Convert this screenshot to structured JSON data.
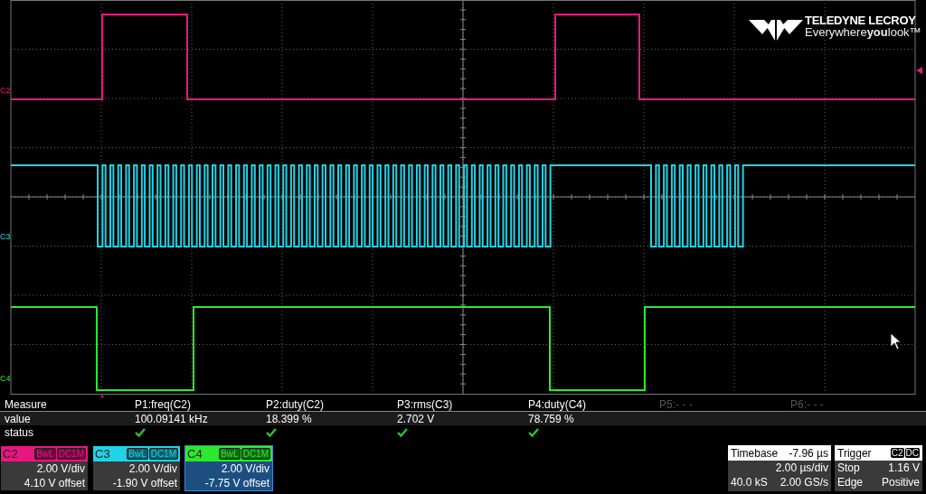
{
  "logo": {
    "brand": "TELEDYNE LECROY",
    "tagline": "Everywhere**you**look™"
  },
  "traces": [
    {
      "label": "C2",
      "color": "#e8177f"
    },
    {
      "label": "C3",
      "color": "#22d3e6"
    },
    {
      "label": "C4",
      "color": "#2ee82e"
    }
  ],
  "measure": {
    "header_label": "Measure",
    "value_label": "value",
    "status_label": "status",
    "params": [
      {
        "name": "P1:freq(C2)",
        "value": "100.09141 kHz",
        "status_ok": true,
        "active": true
      },
      {
        "name": "P2:duty(C2)",
        "value": "18.399 %",
        "status_ok": true,
        "active": true
      },
      {
        "name": "P3:rms(C3)",
        "value": "2.702 V",
        "status_ok": true,
        "active": true
      },
      {
        "name": "P4:duty(C4)",
        "value": "78.759 %",
        "status_ok": true,
        "active": true
      },
      {
        "name": "P5:- - -",
        "active": false,
        "status_ok": false
      },
      {
        "name": "P6:- - -",
        "active": false,
        "status_ok": false
      }
    ]
  },
  "channels": [
    {
      "name": "C2",
      "color": "#e8177f",
      "tags": [
        "BwL",
        "DC1M"
      ],
      "vdiv": "2.00 V/div",
      "offset": "4.10 V offset",
      "selected": false
    },
    {
      "name": "C3",
      "color": "#22d3e6",
      "tags": [
        "BwL",
        "DC1M"
      ],
      "vdiv": "2.00 V/div",
      "offset": "-1.90 V offset",
      "selected": false
    },
    {
      "name": "C4",
      "color": "#2ee82e",
      "tags": [
        "BwL",
        "DC1M"
      ],
      "vdiv": "2.00 V/div",
      "offset": "-7.75 V offset",
      "selected": true
    }
  ],
  "timebase": {
    "title": "Timebase",
    "delay": "-7.96 µs",
    "tdiv": "2.00 µs/div",
    "samples": "40.0 kS",
    "rate": "2.00 GS/s"
  },
  "trigger": {
    "title": "Trigger",
    "source": "C2",
    "coupling": "DC",
    "mode": "Stop",
    "level": "1.16 V",
    "type": "Edge",
    "slope": "Positive"
  }
}
